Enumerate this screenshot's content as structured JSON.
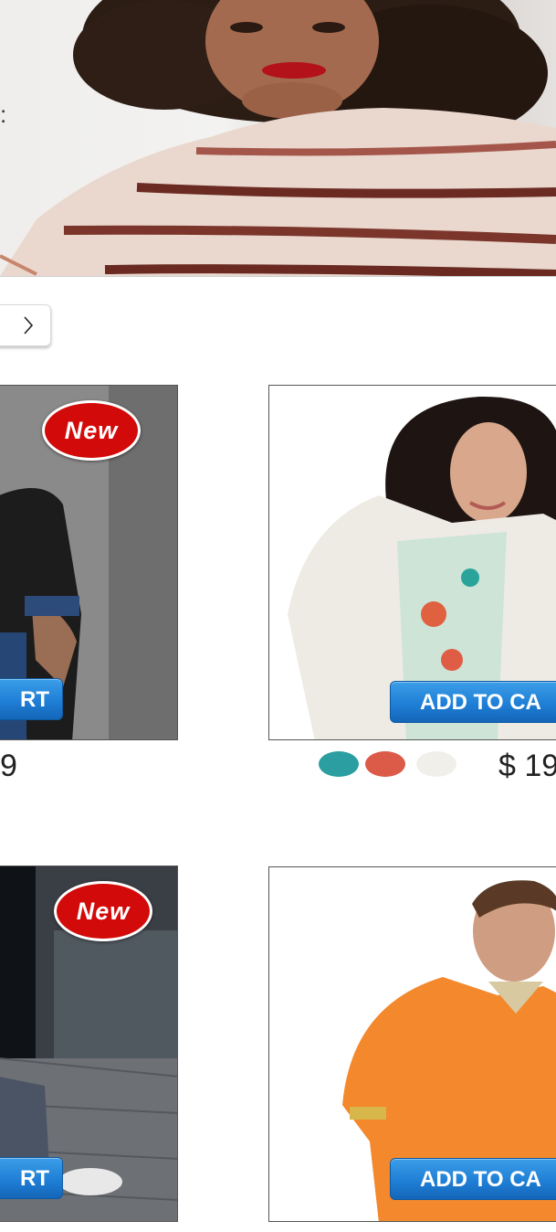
{
  "hero": {
    "colon_text": ":",
    "image": "woman-striped-sweater-photo"
  },
  "nav": {
    "next_icon": "chevron-right-icon"
  },
  "products": [
    {
      "badge": "New",
      "cart_label": "RT",
      "price": "9",
      "image": "man-black-jacket-photo"
    },
    {
      "cart_label": "ADD TO CA",
      "price": "$ 19",
      "image": "woman-white-cardigan-photo",
      "swatches": [
        "#2a9ea0",
        "#dc5a48",
        "#f1efe9"
      ]
    },
    {
      "badge": "New",
      "cart_label": "RT",
      "image": "street-jeans-photo"
    },
    {
      "cart_label": "ADD TO CA",
      "image": "man-orange-sweater-photo"
    }
  ]
}
